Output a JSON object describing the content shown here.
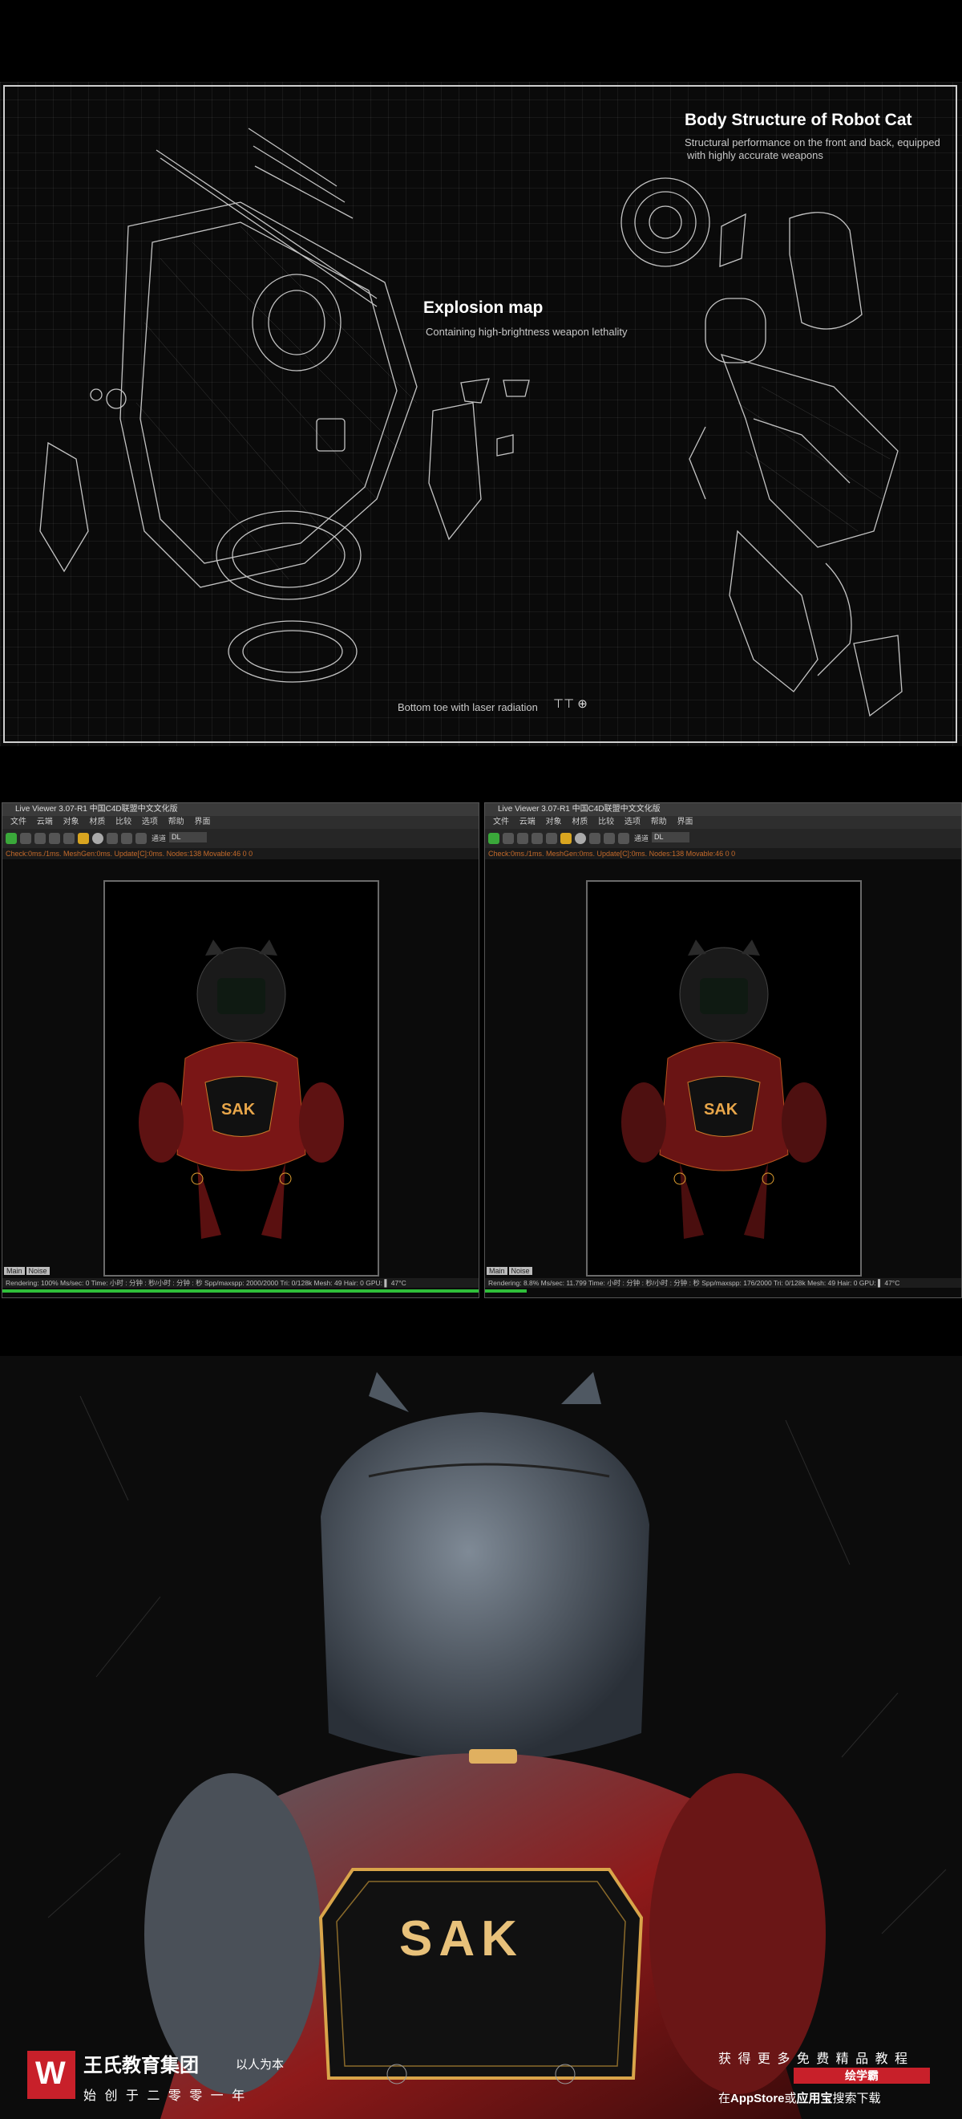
{
  "blueprint": {
    "title": "Body Structure of Robot Cat",
    "subtitle_line1": "Structural performance on the front and back, equipped",
    "subtitle_line2": "with highly accurate weapons",
    "explosion_title": "Explosion map",
    "explosion_sub": "Containing high-brightness weapon lethality",
    "bottom_note": "Bottom toe with laser radiation"
  },
  "viewers": [
    {
      "title": "Live Viewer 3.07-R1 中国C4D联盟中文文化版",
      "menu": [
        "文件",
        "云端",
        "对象",
        "材质",
        "比较",
        "选项",
        "帮助",
        "界面"
      ],
      "channel_label": "通道",
      "channel_value": "DL",
      "stats": "Check:0ms./1ms. MeshGen:0ms. Update[C]:0ms. Nodes:138 Movable:46 0 0",
      "tabs": [
        "Main",
        "Noise"
      ],
      "status": "Rendering: 100%    Ms/sec: 0    Time: 小时 : 分钟 : 秒/小时 : 分钟 : 秒    Spp/maxspp: 2000/2000    Tri: 0/128k    Mesh: 49    Hair: 0    GPU: ▌ 47°C",
      "progress": 1.0
    },
    {
      "title": "Live Viewer 3.07-R1 中国C4D联盟中文文化版",
      "menu": [
        "文件",
        "云端",
        "对象",
        "材质",
        "比较",
        "选项",
        "帮助",
        "界面"
      ],
      "channel_label": "通道",
      "channel_value": "DL",
      "stats": "Check:0ms./1ms. MeshGen:0ms. Update[C]:0ms. Nodes:138 Movable:46 0 0",
      "tabs": [
        "Main",
        "Noise"
      ],
      "status": "Rendering: 8.8%    Ms/sec: 11.799    Time: 小时 : 分钟 : 秒/小时 : 分钟 : 秒    Spp/maxspp: 176/2000    Tri: 0/128k    Mesh: 49    Hair: 0    GPU: ▌ 47°C",
      "progress": 0.088
    }
  ],
  "hero": {
    "chest_logo": "SAK",
    "brand_name": "王氏教育集团",
    "brand_slogan": "以人为本",
    "brand_tagline": "始 创 于 二 零 零 一 年",
    "promo_line1": "获 得 更 多 免 费 精 品 教 程",
    "promo_badge": "绘学霸",
    "promo_line2_a": "在",
    "promo_line2_b": "AppStore",
    "promo_line2_c": "或",
    "promo_line2_d": "应用宝",
    "promo_line2_e": "搜索下载"
  },
  "colors": {
    "accent_green": "#2fbf3a",
    "robot_red": "#8e1a1a",
    "badge_red": "#c8202a"
  }
}
